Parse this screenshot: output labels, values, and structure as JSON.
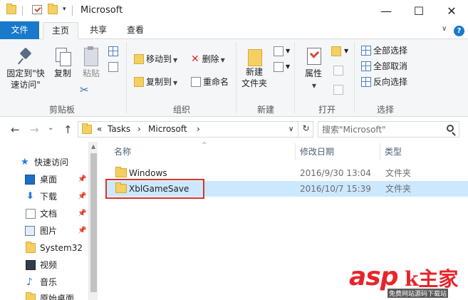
{
  "window": {
    "title": "Microsoft",
    "minimize_glyph": "—",
    "maximize_glyph": "☐",
    "close_glyph": "✕"
  },
  "quick_access": {
    "dropdown_glyph": "▾"
  },
  "ribbon_tabs": {
    "file": "文件",
    "home": "主页",
    "share": "共享",
    "view": "查看",
    "collapse_glyph": "∨",
    "help_glyph": "?"
  },
  "ribbon": {
    "clipboard": {
      "label": "剪贴板",
      "pin": "固定到\"快\n速访问\"",
      "copy": "复制",
      "paste": "粘贴",
      "cut_glyph": "✂"
    },
    "organize": {
      "label": "组织",
      "move_to": "移动到",
      "copy_to": "复制到",
      "delete": "删除",
      "rename": "重命名"
    },
    "new": {
      "label": "新建",
      "new_folder": "新建\n文件夹"
    },
    "open": {
      "label": "打开",
      "properties": "属性"
    },
    "select": {
      "label": "选择",
      "select_all": "全部选择",
      "select_none": "全部取消",
      "invert": "反向选择"
    }
  },
  "nav": {
    "back_glyph": "←",
    "forward_glyph": "→",
    "recent_glyph": "⌄",
    "up_glyph": "↑",
    "address": {
      "overflow": "«",
      "crumbs": [
        "Tasks",
        "Microsoft"
      ],
      "sep": "›"
    },
    "dropdown_glyph": "∨",
    "refresh_glyph": "↻",
    "search_placeholder": "搜索\"Microsoft\""
  },
  "nav_pane": {
    "items": [
      {
        "label": "快速访问",
        "icon": "star-icon"
      },
      {
        "label": "桌面",
        "icon": "desktop-icon",
        "pinned": true
      },
      {
        "label": "下载",
        "icon": "download-icon",
        "pinned": true
      },
      {
        "label": "文档",
        "icon": "documents-icon",
        "pinned": true
      },
      {
        "label": "图片",
        "icon": "pictures-icon",
        "pinned": true
      },
      {
        "label": "System32",
        "icon": "folder-icon"
      },
      {
        "label": "视频",
        "icon": "videos-icon"
      },
      {
        "label": "音乐",
        "icon": "music-icon"
      },
      {
        "label": "原始桌面",
        "icon": "folder-icon"
      }
    ],
    "pin_glyph": "📌"
  },
  "file_list": {
    "columns": {
      "name": "名称",
      "date": "修改日期",
      "type": "类型"
    },
    "sort_glyph": "^",
    "rows": [
      {
        "name": "Windows",
        "date": "2016/9/30 13:04",
        "type": "文件夹",
        "selected": false
      },
      {
        "name": "XblGameSave",
        "date": "2016/10/7 15:39",
        "type": "文件夹",
        "selected": true
      }
    ]
  },
  "watermark": {
    "brand": "asp",
    "suffix": "k主家",
    "sub": "免费网站源码下载站"
  },
  "colors": {
    "accent": "#1979ca",
    "selection": "#cce8ff",
    "highlight_box": "#d9312b",
    "folder": "#f4d062"
  }
}
